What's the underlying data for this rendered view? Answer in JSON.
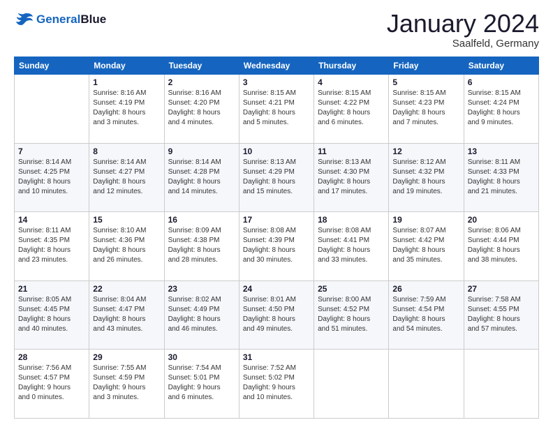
{
  "logo": {
    "line1": "General",
    "line2": "Blue"
  },
  "title": "January 2024",
  "location": "Saalfeld, Germany",
  "days_header": [
    "Sunday",
    "Monday",
    "Tuesday",
    "Wednesday",
    "Thursday",
    "Friday",
    "Saturday"
  ],
  "weeks": [
    [
      {
        "num": "",
        "info": ""
      },
      {
        "num": "1",
        "info": "Sunrise: 8:16 AM\nSunset: 4:19 PM\nDaylight: 8 hours\nand 3 minutes."
      },
      {
        "num": "2",
        "info": "Sunrise: 8:16 AM\nSunset: 4:20 PM\nDaylight: 8 hours\nand 4 minutes."
      },
      {
        "num": "3",
        "info": "Sunrise: 8:15 AM\nSunset: 4:21 PM\nDaylight: 8 hours\nand 5 minutes."
      },
      {
        "num": "4",
        "info": "Sunrise: 8:15 AM\nSunset: 4:22 PM\nDaylight: 8 hours\nand 6 minutes."
      },
      {
        "num": "5",
        "info": "Sunrise: 8:15 AM\nSunset: 4:23 PM\nDaylight: 8 hours\nand 7 minutes."
      },
      {
        "num": "6",
        "info": "Sunrise: 8:15 AM\nSunset: 4:24 PM\nDaylight: 8 hours\nand 9 minutes."
      }
    ],
    [
      {
        "num": "7",
        "info": "Sunrise: 8:14 AM\nSunset: 4:25 PM\nDaylight: 8 hours\nand 10 minutes."
      },
      {
        "num": "8",
        "info": "Sunrise: 8:14 AM\nSunset: 4:27 PM\nDaylight: 8 hours\nand 12 minutes."
      },
      {
        "num": "9",
        "info": "Sunrise: 8:14 AM\nSunset: 4:28 PM\nDaylight: 8 hours\nand 14 minutes."
      },
      {
        "num": "10",
        "info": "Sunrise: 8:13 AM\nSunset: 4:29 PM\nDaylight: 8 hours\nand 15 minutes."
      },
      {
        "num": "11",
        "info": "Sunrise: 8:13 AM\nSunset: 4:30 PM\nDaylight: 8 hours\nand 17 minutes."
      },
      {
        "num": "12",
        "info": "Sunrise: 8:12 AM\nSunset: 4:32 PM\nDaylight: 8 hours\nand 19 minutes."
      },
      {
        "num": "13",
        "info": "Sunrise: 8:11 AM\nSunset: 4:33 PM\nDaylight: 8 hours\nand 21 minutes."
      }
    ],
    [
      {
        "num": "14",
        "info": "Sunrise: 8:11 AM\nSunset: 4:35 PM\nDaylight: 8 hours\nand 23 minutes."
      },
      {
        "num": "15",
        "info": "Sunrise: 8:10 AM\nSunset: 4:36 PM\nDaylight: 8 hours\nand 26 minutes."
      },
      {
        "num": "16",
        "info": "Sunrise: 8:09 AM\nSunset: 4:38 PM\nDaylight: 8 hours\nand 28 minutes."
      },
      {
        "num": "17",
        "info": "Sunrise: 8:08 AM\nSunset: 4:39 PM\nDaylight: 8 hours\nand 30 minutes."
      },
      {
        "num": "18",
        "info": "Sunrise: 8:08 AM\nSunset: 4:41 PM\nDaylight: 8 hours\nand 33 minutes."
      },
      {
        "num": "19",
        "info": "Sunrise: 8:07 AM\nSunset: 4:42 PM\nDaylight: 8 hours\nand 35 minutes."
      },
      {
        "num": "20",
        "info": "Sunrise: 8:06 AM\nSunset: 4:44 PM\nDaylight: 8 hours\nand 38 minutes."
      }
    ],
    [
      {
        "num": "21",
        "info": "Sunrise: 8:05 AM\nSunset: 4:45 PM\nDaylight: 8 hours\nand 40 minutes."
      },
      {
        "num": "22",
        "info": "Sunrise: 8:04 AM\nSunset: 4:47 PM\nDaylight: 8 hours\nand 43 minutes."
      },
      {
        "num": "23",
        "info": "Sunrise: 8:02 AM\nSunset: 4:49 PM\nDaylight: 8 hours\nand 46 minutes."
      },
      {
        "num": "24",
        "info": "Sunrise: 8:01 AM\nSunset: 4:50 PM\nDaylight: 8 hours\nand 49 minutes."
      },
      {
        "num": "25",
        "info": "Sunrise: 8:00 AM\nSunset: 4:52 PM\nDaylight: 8 hours\nand 51 minutes."
      },
      {
        "num": "26",
        "info": "Sunrise: 7:59 AM\nSunset: 4:54 PM\nDaylight: 8 hours\nand 54 minutes."
      },
      {
        "num": "27",
        "info": "Sunrise: 7:58 AM\nSunset: 4:55 PM\nDaylight: 8 hours\nand 57 minutes."
      }
    ],
    [
      {
        "num": "28",
        "info": "Sunrise: 7:56 AM\nSunset: 4:57 PM\nDaylight: 9 hours\nand 0 minutes."
      },
      {
        "num": "29",
        "info": "Sunrise: 7:55 AM\nSunset: 4:59 PM\nDaylight: 9 hours\nand 3 minutes."
      },
      {
        "num": "30",
        "info": "Sunrise: 7:54 AM\nSunset: 5:01 PM\nDaylight: 9 hours\nand 6 minutes."
      },
      {
        "num": "31",
        "info": "Sunrise: 7:52 AM\nSunset: 5:02 PM\nDaylight: 9 hours\nand 10 minutes."
      },
      {
        "num": "",
        "info": ""
      },
      {
        "num": "",
        "info": ""
      },
      {
        "num": "",
        "info": ""
      }
    ]
  ]
}
